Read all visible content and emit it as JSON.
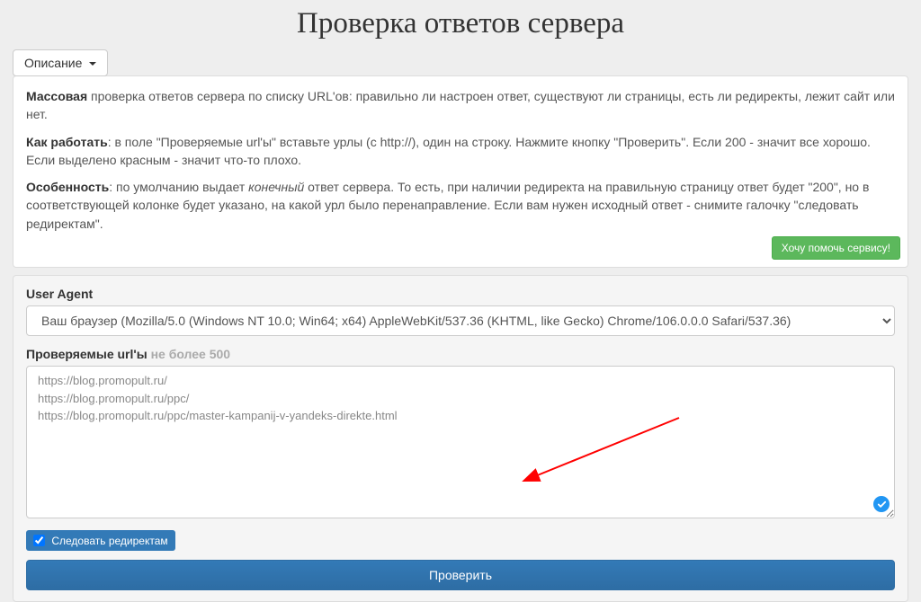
{
  "title": "Проверка ответов сервера",
  "dropdown_label": "Описание",
  "description": {
    "p1_bold": "Массовая",
    "p1_rest": " проверка ответов сервера по списку URL'ов: правильно ли настроен ответ, существуют ли страницы, есть ли редиректы, лежит сайт или нет.",
    "p2_bold": "Как работать",
    "p2_rest": ": в поле \"Проверяемые url'ы\" вставьте урлы (с http://), один на строку. Нажмите кнопку \"Проверить\". Если 200 - значит все хорошо. Если выделено красным - значит что-то плохо.",
    "p3_bold": "Особенность",
    "p3_part1": ": по умолчанию выдает ",
    "p3_em": "конечный",
    "p3_part2": " ответ сервера. То есть, при наличии редиректа на правильную страницу ответ будет \"200\", но в соответствующей колонке будет указано, на какой урл было перенаправление. Если вам нужен исходный ответ - снимите галочку \"следовать редиректам\"."
  },
  "help_button": "Хочу помочь сервису!",
  "form": {
    "user_agent_label": "User Agent",
    "user_agent_value": "Ваш браузер (Mozilla/5.0 (Windows NT 10.0; Win64; x64) AppleWebKit/537.36 (KHTML, like Gecko) Chrome/106.0.0.0 Safari/537.36)",
    "urls_label": "Проверяемые url'ы",
    "urls_note": " не более 500",
    "urls_value": "https://blog.promopult.ru/\nhttps://blog.promopult.ru/ppc/\nhttps://blog.promopult.ru/ppc/master-kampanij-v-yandeks-direkte.html",
    "follow_redirects_label": "Следовать редиректам",
    "submit_label": "Проверить"
  }
}
